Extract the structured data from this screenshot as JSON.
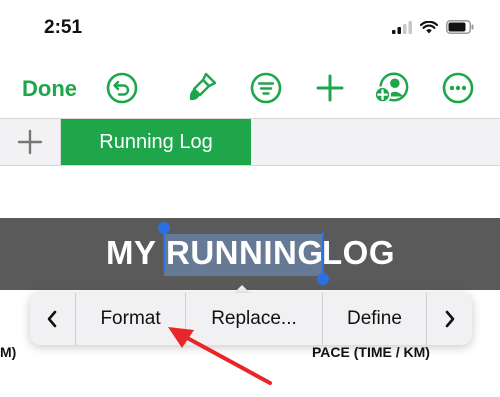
{
  "status_bar": {
    "time": "2:51",
    "icons": [
      "signal-icon",
      "wifi-icon",
      "battery-icon"
    ]
  },
  "toolbar": {
    "done_label": "Done",
    "icons": [
      "undo-icon",
      "paintbrush-icon",
      "filter-icon",
      "plus-icon",
      "collaborate-icon",
      "more-icon"
    ],
    "accent_color": "#1fa64b"
  },
  "tabs": {
    "add_icon": "plus-icon",
    "active_tab": "Running Log"
  },
  "sheet": {
    "title_before": "MY ",
    "title_selected": "RUNNING",
    "title_after": " LOG",
    "band_color": "#5a5a5a",
    "selection_color": "#2c6fe0"
  },
  "context_menu": {
    "items": [
      "Format",
      "Replace...",
      "Define"
    ],
    "prev_icon": "chevron-left-icon",
    "next_icon": "chevron-right-icon"
  },
  "table": {
    "left_header_fragment": "M)",
    "pace_header": "PACE (TIME / KM)"
  },
  "annotation": {
    "arrow_color": "#e8262a"
  }
}
